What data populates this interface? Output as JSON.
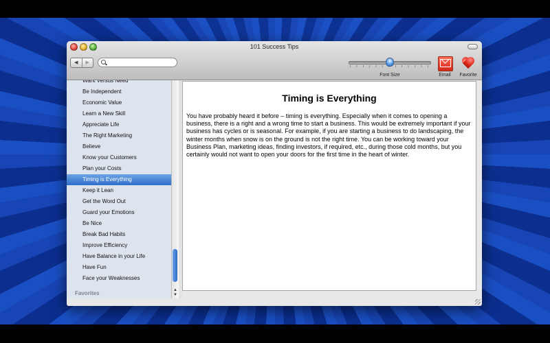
{
  "window": {
    "title": "101 Success Tips"
  },
  "toolbar": {
    "back_icon": "◀",
    "forward_icon": "▶",
    "search_placeholder": "",
    "font_size_label": "Font Size",
    "font_size_value": 0.5,
    "email_label": "Email",
    "favorite_label": "Favorite"
  },
  "sidebar": {
    "items": [
      {
        "label": "Want Versus Need"
      },
      {
        "label": "Be Independent"
      },
      {
        "label": "Economic Value"
      },
      {
        "label": "Learn a New Skill"
      },
      {
        "label": "Appreciate Life"
      },
      {
        "label": "The Right Marketing"
      },
      {
        "label": "Believe"
      },
      {
        "label": "Know your Customers"
      },
      {
        "label": "Plan your Costs"
      },
      {
        "label": "Timing is Everything",
        "selected": true
      },
      {
        "label": "Keep it Lean"
      },
      {
        "label": "Get the Word Out"
      },
      {
        "label": "Guard your Emotions"
      },
      {
        "label": "Be Nice"
      },
      {
        "label": "Break Bad Habits"
      },
      {
        "label": "Improve Efficiency"
      },
      {
        "label": "Have Balance in your Life"
      },
      {
        "label": "Have Fun"
      },
      {
        "label": "Face your Weaknesses"
      }
    ],
    "section_label": "Favorites",
    "scroll_up": "▲",
    "scroll_down": "▼"
  },
  "article": {
    "title": "Timing is Everything",
    "body": "You have probably heard it before – timing is everything. Especially when it comes to opening a business, there is a right and a wrong time to start a business. This would be extremely important if your business has cycles or is seasonal. For example, if you are starting a business to do landscaping, the winter months when snow is on the ground is not the right time. You can be working toward your Business Plan, marketing ideas, finding investors, if required, etc., during those cold months, but you certainly would not want to open your doors for the first time in the heart of winter."
  },
  "colors": {
    "selection": "#2f6fca",
    "sidebar_bg": "#dde4ee",
    "desktop": "#0b2e8f"
  }
}
